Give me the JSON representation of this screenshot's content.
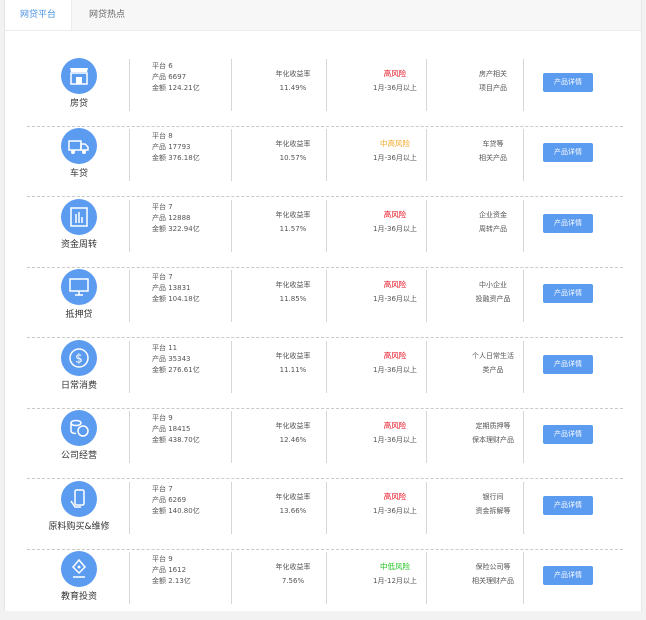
{
  "tabs": [
    {
      "label": "网贷平台",
      "active": true
    },
    {
      "label": "网贷热点",
      "active": false
    }
  ],
  "colors": {
    "accent": "#5b9bf0",
    "tab_active": "#4a90e2",
    "risk_high": "#e60012",
    "risk_medium_high": "#f5a623",
    "risk_medium_low": "#19c219"
  },
  "button_label": "产品详情",
  "rate_label": "年化收益率",
  "categories": [
    {
      "name": "房贷",
      "icon": "shop-icon",
      "platforms": "平台 6",
      "products": "产品 6697",
      "amount": "金额 124.21亿",
      "rate": "11.49%",
      "risk": "高风险",
      "risk_color": "#e60012",
      "term": "1月-36月以上",
      "desc1": "房产相关",
      "desc2": "项目产品"
    },
    {
      "name": "车贷",
      "icon": "truck-icon",
      "platforms": "平台 8",
      "products": "产品 17793",
      "amount": "金额 376.18亿",
      "rate": "10.57%",
      "risk": "中高风险",
      "risk_color": "#f5a623",
      "term": "1月-36月以上",
      "desc1": "车贷等",
      "desc2": "相关产品"
    },
    {
      "name": "资金周转",
      "icon": "hand-icon",
      "platforms": "平台 7",
      "products": "产品 12888",
      "amount": "金额 322.94亿",
      "rate": "11.57%",
      "risk": "高风险",
      "risk_color": "#e60012",
      "term": "1月-36月以上",
      "desc1": "企业资金",
      "desc2": "周转产品"
    },
    {
      "name": "抵押贷",
      "icon": "monitor-icon",
      "platforms": "平台 7",
      "products": "产品 13831",
      "amount": "金额 104.18亿",
      "rate": "11.85%",
      "risk": "高风险",
      "risk_color": "#e60012",
      "term": "1月-36月以上",
      "desc1": "中小企业",
      "desc2": "投融资产品"
    },
    {
      "name": "日常消费",
      "icon": "dollar-icon",
      "platforms": "平台 11",
      "products": "产品 35343",
      "amount": "金额 276.61亿",
      "rate": "11.11%",
      "risk": "高风险",
      "risk_color": "#e60012",
      "term": "1月-36月以上",
      "desc1": "个人日常生活",
      "desc2": "类产品"
    },
    {
      "name": "公司经营",
      "icon": "coins-icon",
      "platforms": "平台 9",
      "products": "产品 18415",
      "amount": "金额 438.70亿",
      "rate": "12.46%",
      "risk": "高风险",
      "risk_color": "#e60012",
      "term": "1月-36月以上",
      "desc1": "定期质押等",
      "desc2": "保本理财产品"
    },
    {
      "name": "原料购买&维修",
      "icon": "phone-hand-icon",
      "platforms": "平台 7",
      "products": "产品 6269",
      "amount": "金额 140.80亿",
      "rate": "13.66%",
      "risk": "高风险",
      "risk_color": "#e60012",
      "term": "1月-36月以上",
      "desc1": "银行间",
      "desc2": "资金拆解等"
    },
    {
      "name": "教育投资",
      "icon": "pen-icon",
      "platforms": "平台 9",
      "products": "产品 1612",
      "amount": "金额 2.13亿",
      "rate": "7.56%",
      "risk": "中低风险",
      "risk_color": "#19c219",
      "term": "1月-12月以上",
      "desc1": "保险公司等",
      "desc2": "相关理财产品"
    }
  ]
}
